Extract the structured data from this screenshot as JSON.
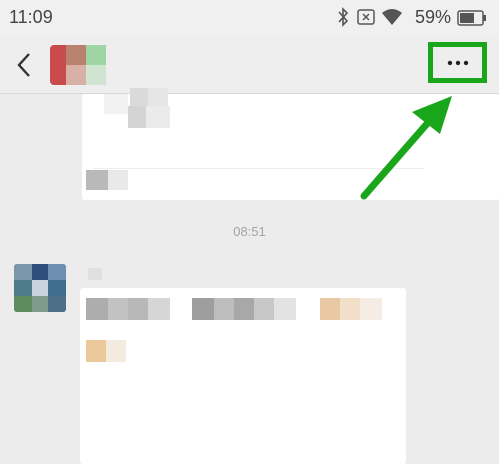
{
  "status_bar": {
    "time": "11:09",
    "battery_percent": "59%",
    "icons": [
      "bluetooth-icon",
      "close-box-icon",
      "wifi-icon",
      "battery-icon"
    ]
  },
  "nav": {
    "back_icon": "chevron-left-icon",
    "more_icon": "ellipsis-icon",
    "more_label": "···",
    "highlight_color": "#1aa61a"
  },
  "chat": {
    "timestamp": "08:51"
  },
  "annotation": {
    "arrow_color": "#1aa61a"
  }
}
